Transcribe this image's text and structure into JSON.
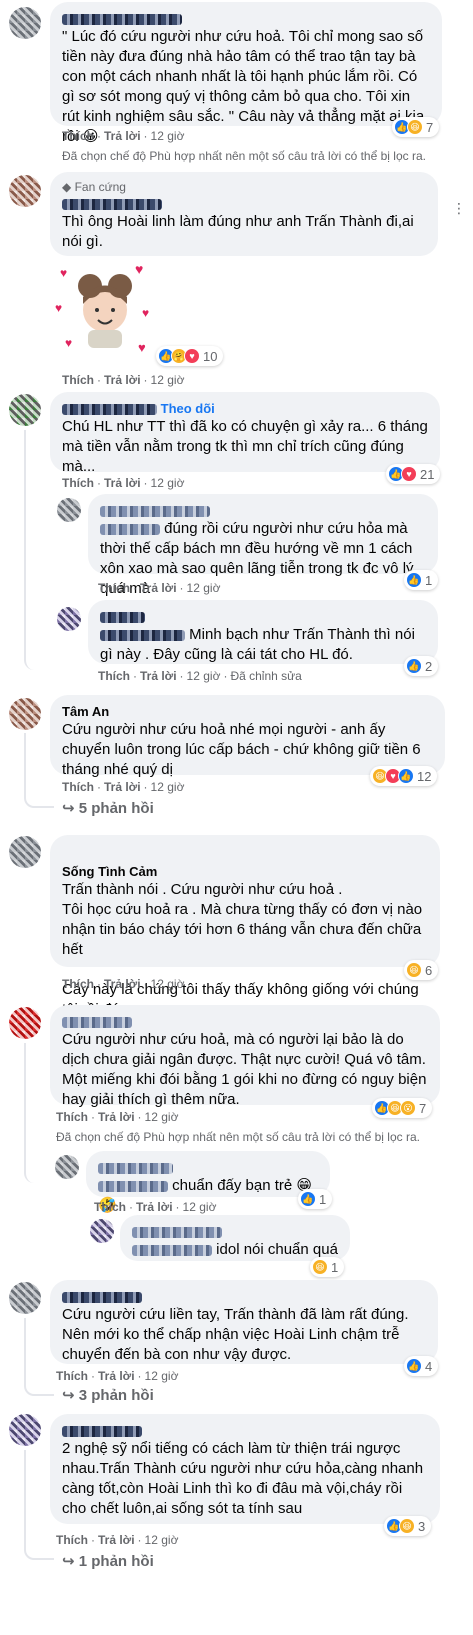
{
  "labels": {
    "like": "Thích",
    "reply": "Trả lời",
    "dot": "·",
    "edited": "Đã chỉnh sửa",
    "filter_note": "Đã chọn chế độ Phù hợp nhất nên một số câu trả lời có thể bị lọc ra.",
    "fan_badge": "Fan cứng",
    "follow": "Theo dõi"
  },
  "comments": [
    {
      "author": "",
      "text": "\" Lúc đó cứu người như cứu hoả. Tôi chỉ mong sao số tiền này đưa đúng nhà hảo tâm có thể trao tận tay bà con một cách nhanh nhất là tôi hạnh phúc lắm rồi. Có gì sơ sót mong quý vị thông cảm bỏ qua cho. Tôi xin rút kinh nghiệm sâu sắc. \" Câu này vả thẳng mặt ai kia rồi 😀",
      "time": "12 giờ",
      "reactions": "7"
    },
    {
      "author": "",
      "text": "Thì ông Hoài linh làm đúng như anh Trấn Thành đi,ai nói gì.",
      "time": "12 giờ",
      "reactions": "10"
    },
    {
      "author": "",
      "text": "Chú HL như TT thì đã ko có chuyện gì xảy ra... 6 tháng mà tiền vẫn nằm trong tk thì mn chỉ trích cũng đúng mà...",
      "time": "12 giờ",
      "reactions": "21"
    },
    {
      "author": "",
      "text": "đúng rồi cứu người như cứu hỏa mà thời thế cấp bách mn đều hướng về mn 1 cách xôn xao mà sao quên lãng tiễn trong tk đc vô lý quá mà",
      "time": "12 giờ",
      "reactions": "1"
    },
    {
      "author": "",
      "text": "Minh bạch như Trấn Thành thì nói gì này . Đây cũng là cái tát cho HL đó.",
      "time": "12 giờ",
      "reactions": "2"
    },
    {
      "author": "Tâm An",
      "text": "Cứu người như cứu hoả nhé mọi người - anh ấy chuyển luôn trong lúc cấp bách - chứ không giữ tiền 6 tháng nhé quý dị",
      "time": "12 giờ",
      "reactions": "12",
      "replies": "5 phản hồi"
    },
    {
      "author": "Sống Tình Cảm",
      "text": "Trấn thành nói . Cứu người như cứu hoả .\nTôi học cứu hoả ra . Mà chưa từng thấy có đơn vị nào nhận tin báo cháy tới hơn 6 tháng vẫn chưa đến chữa hết\n\nCáy này là chúng tôi thấy thấy không giống với chúng tôi rồi đó .",
      "time": "12 giờ",
      "reactions": "6"
    },
    {
      "author": "",
      "text": "Cứu người như cứu hoả, mà có người lại bảo là do dịch chưa giải ngân được. Thật nực cười! Quá vô tâm. Một miếng khi đói bằng 1 gói khi no đừng có nguy biện hay giải thích gì thêm nữa.",
      "time": "12 giờ",
      "reactions": "7"
    },
    {
      "author": "",
      "text": "chuẩn đấy bạn trẻ 😁🤣",
      "time": "12 giờ",
      "reactions": "1"
    },
    {
      "author": "",
      "text": "idol nói chuẩn quá",
      "time": "12 giờ",
      "reactions": "1"
    },
    {
      "author": "",
      "text": "Cứu người cứu liền tay, Trấn thành đã làm rất đúng. Nên mới ko thể chấp nhận việc Hoài Linh chậm trễ chuyển đến bà con như vậy được.",
      "time": "12 giờ",
      "reactions": "4",
      "replies": "3 phản hồi"
    },
    {
      "author": "",
      "text": "2 nghệ sỹ nổi tiếng có cách làm từ thiện trái ngược nhau.Trấn Thành cứu người như cứu hỏa,càng nhanh càng tốt,còn Hoài Linh thì ko đi đâu mà vội,cháy rồi cho chết luôn,ai sống sót ta tính sau",
      "time": "12 giờ",
      "reactions": "3",
      "replies": "1 phản hồi"
    }
  ],
  "colors": {
    "like": "#1877f2",
    "love": "#f33e58",
    "haha": "#f7b125",
    "bubble": "#f0f2f5",
    "meta": "#65676b"
  }
}
